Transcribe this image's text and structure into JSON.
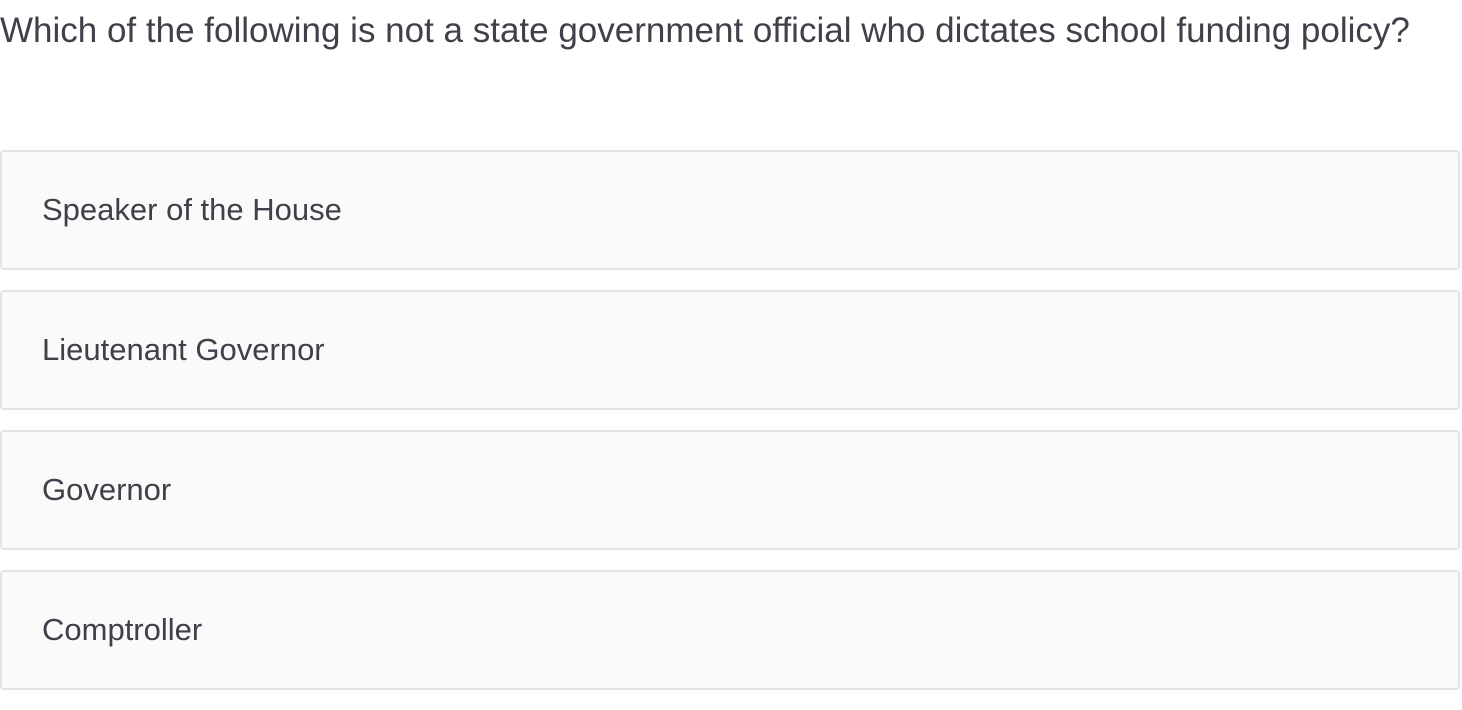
{
  "question": {
    "text": "Which of the following is not a state government official who dictates school funding policy?"
  },
  "options": [
    {
      "label": "Speaker of the House"
    },
    {
      "label": "Lieutenant Governor"
    },
    {
      "label": "Governor"
    },
    {
      "label": "Comptroller"
    }
  ]
}
